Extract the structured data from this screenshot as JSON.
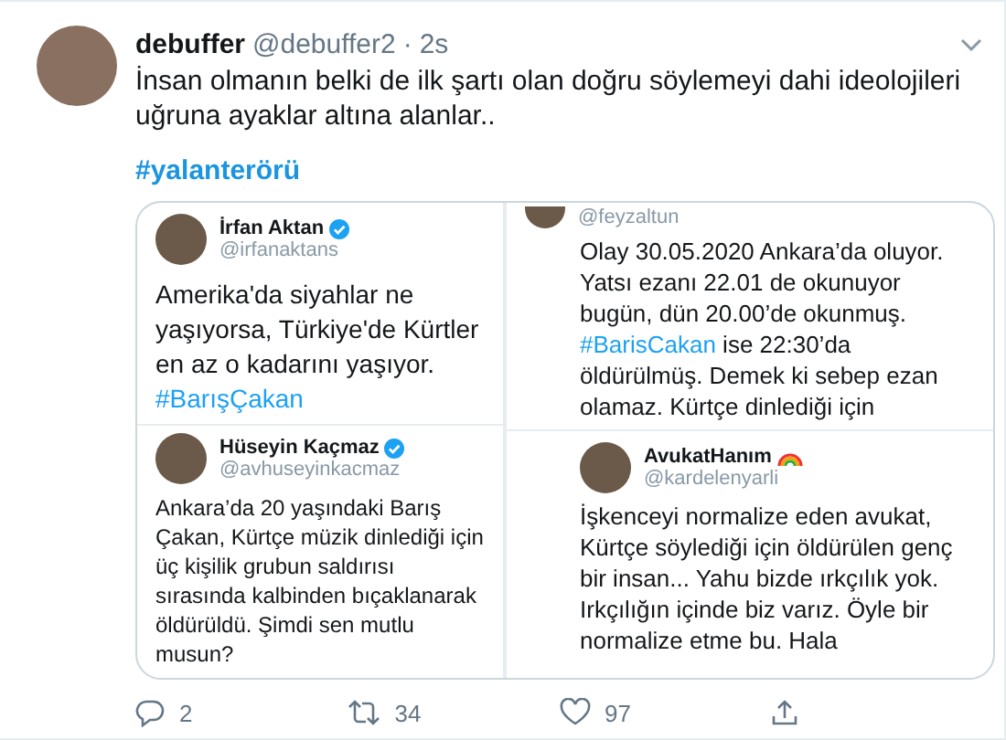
{
  "tweet": {
    "name": "debuffer",
    "handle": "@debuffer2",
    "separator": "·",
    "time": "2s",
    "text": "İnsan olmanın belki de ilk şartı olan doğru söylemeyi dahi ideolojileri uğruna ayaklar altına alanlar..",
    "hashtag": "#yalanterörü",
    "media": {
      "columns": [
        {
          "posts": [
            {
              "name": "İrfan Aktan",
              "kind": "verified",
              "handle": "@irfanaktans",
              "segments": [
                {
                  "kind": "plain",
                  "text": "Amerika'da siyahlar ne yaşıyorsa, Türkiye'de Kürtler en az o kadarını yaşıyor."
                },
                {
                  "kind": "break"
                },
                {
                  "kind": "hashtag",
                  "text": "#BarışÇakan"
                }
              ]
            },
            {
              "name": "Hüseyin Kaçmaz",
              "kind": "verified",
              "handle": "@avhuseyinkacmaz",
              "segments": [
                {
                  "kind": "plain",
                  "text": "Ankara’da 20 yaşındaki Barış Çakan, Kürtçe müzik dinlediği için üç kişilik grubun saldırısı sırasında kalbinden bıçaklanarak öldürüldü. Şimdi sen mutlu musun?"
                }
              ]
            }
          ]
        },
        {
          "posts": [
            {
              "handle": "@feyzaltun",
              "segments": [
                {
                  "kind": "plain",
                  "text": "Olay 30.05.2020 Ankara’da oluyor. Yatsı ezanı 22.01 de okunuyor bugün, dün 20.00’de okunmuş. "
                },
                {
                  "kind": "hashtag",
                  "text": "#BarisCakan"
                },
                {
                  "kind": "plain",
                  "text": " ise 22:30’da öldürülmüş. Demek ki sebep ezan olamaz. Kürtçe dinlediği için"
                }
              ]
            },
            {
              "name": "AvukatHanım",
              "kind": "rainbow",
              "handle": "@kardelenyarli",
              "segments": [
                {
                  "kind": "plain",
                  "text": "İşkenceyi normalize eden avukat, Kürtçe söylediği için öldürülen genç bir insan... Yahu bizde ırkçılık yok. Irkçılığın içinde biz varız. Öyle bir normalize etme bu. Hala"
                }
              ]
            }
          ]
        }
      ]
    },
    "actions": [
      {
        "kind": "reply",
        "count": "2"
      },
      {
        "kind": "retweet",
        "count": "34"
      },
      {
        "kind": "like",
        "count": "97"
      },
      {
        "kind": "share"
      }
    ]
  }
}
